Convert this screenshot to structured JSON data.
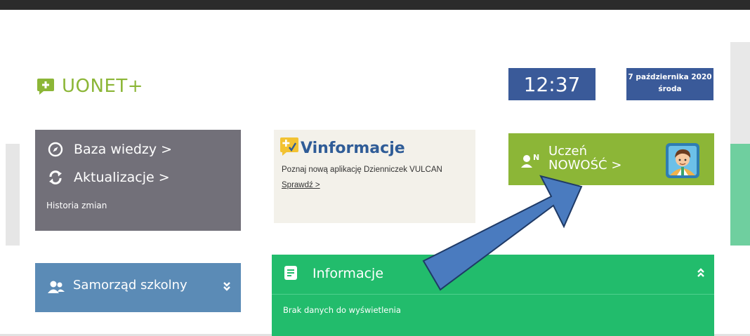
{
  "logo": {
    "text": "UONET+",
    "icon": "plus-chat-icon",
    "color": "#8cb637"
  },
  "clock": {
    "time": "12:37"
  },
  "date": {
    "line1": "7 października 2020",
    "line2": "środa"
  },
  "baza": {
    "items": [
      {
        "label": "Baza wiedzy >",
        "icon": "compass-icon"
      },
      {
        "label": "Aktualizacje >",
        "icon": "refresh-icon"
      }
    ],
    "history_label": "Historia zmian"
  },
  "vinfo": {
    "title": "Vinformacje",
    "text": "Poznaj nową aplikację Dzienniczek VULCAN",
    "link": "Sprawdź >"
  },
  "uczen": {
    "line1": "Uczeń",
    "line2": "NOWOŚĆ >",
    "icon": "student-n-icon"
  },
  "samorzad": {
    "label": "Samorząd szkolny",
    "icon": "users-icon"
  },
  "informacje": {
    "title": "Informacje",
    "body": "Brak danych do wyświetlenia",
    "icon": "news-icon"
  },
  "colors": {
    "header_bar": "#2b2b2b",
    "date_box": "#3a5a99",
    "baza_panel": "#727079",
    "uczen_tile": "#8cb637",
    "samorzad_panel": "#5b8bb6",
    "info_panel": "#22bc6c",
    "arrow_fill": "#4a7bbf"
  }
}
